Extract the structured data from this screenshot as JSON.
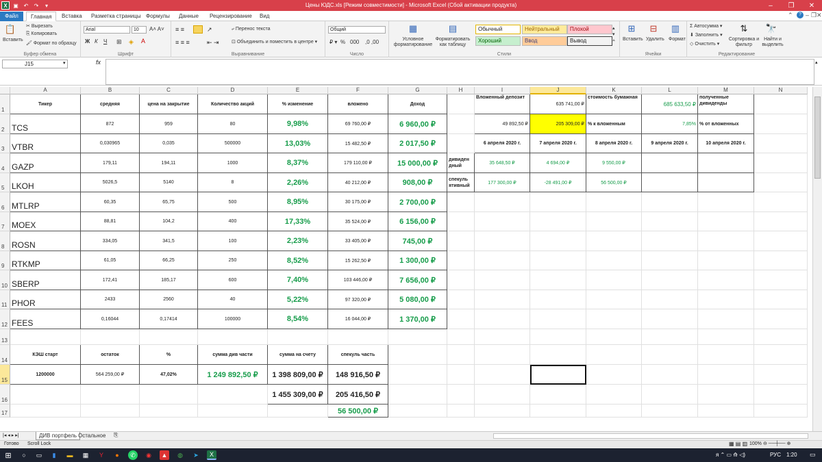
{
  "window": {
    "title": "Цены ЮДС.xls  [Режим совместимости]  -  Microsoft Excel (Сбой активации продукта)"
  },
  "menu": {
    "tabs": [
      "Файл",
      "Главная",
      "Вставка",
      "Разметка страницы",
      "Формулы",
      "Данные",
      "Рецензирование",
      "Вид"
    ]
  },
  "ribbon": {
    "clipboard": {
      "label": "Буфер обмена",
      "paste": "Вставить",
      "cut": "Вырезать",
      "copy": "Копировать",
      "format_painter": "Формат по образцу"
    },
    "font": {
      "label": "Шрифт",
      "name": "Arial",
      "size": "10",
      "bold": "Ж",
      "italic": "К",
      "underline": "Ч"
    },
    "alignment": {
      "label": "Выравнивание",
      "wrap": "Перенос текста",
      "merge": "Объединить и поместить в центре"
    },
    "number": {
      "label": "Число",
      "format": "Общий",
      "percent": "%",
      "thousands": "000"
    },
    "styles": {
      "label": "Стили",
      "conditional": "Условное форматирование",
      "as_table": "Форматировать как таблицу",
      "normal": "Обычный",
      "neutral": "Нейтральный",
      "bad": "Плохой",
      "good": "Хороший",
      "input": "Ввод",
      "output": "Вывод"
    },
    "cells": {
      "label": "Ячейки",
      "insert": "Вставить",
      "delete": "Удалить",
      "format": "Формат"
    },
    "editing": {
      "label": "Редактирование",
      "autosum": "Автосумма",
      "fill": "Заполнить",
      "clear": "Очистить",
      "sort": "Сортировка и фильтр",
      "find": "Найти и выделить"
    }
  },
  "namebox": "J15",
  "fx": "fx",
  "columns": [
    "A",
    "B",
    "C",
    "D",
    "E",
    "F",
    "G",
    "H",
    "I",
    "J",
    "K",
    "L",
    "M",
    "N"
  ],
  "rows": [
    "1",
    "2",
    "3",
    "4",
    "5",
    "6",
    "7",
    "8",
    "9",
    "10",
    "11",
    "12",
    "13",
    "14",
    "15",
    "16",
    "17"
  ],
  "cells": {
    "A1": "Тикер",
    "B1": "средняя",
    "C1": "цена на закрытие",
    "D1": "Количество акций",
    "E1": "% изменение",
    "F1": "вложено",
    "G1": "Доход",
    "I1": "Вложенный депозит",
    "J1": "635 741,00 ₽",
    "K1": "стоимость бумажная",
    "L1": "685 633,50 ₽",
    "M1": "полученные дивиденды",
    "A2": "TCS",
    "B2": "872",
    "C2": "959",
    "D2": "80",
    "E2": "9,98%",
    "F2": "69 760,00 ₽",
    "G2": "6 960,00 ₽",
    "I2": "49 892,50 ₽",
    "J2": "205 309,00 ₽",
    "K2": "% к вложенным",
    "L2": "7,85%",
    "M2": "% от вложенных",
    "A3": "VTBR",
    "B3": "0,030965",
    "C3": "0,035",
    "D3": "500000",
    "E3": "13,03%",
    "F3": "15 482,50 ₽",
    "G3": "2 017,50 ₽",
    "I3": "6 апреля 2020 г.",
    "J3": "7 апреля 2020 г.",
    "K3": "8 апреля 2020 г.",
    "L3": "9 апреля 2020 г.",
    "M3": "10 апреля 2020 г.",
    "A4": "GAZP",
    "B4": "179,11",
    "C4": "194,11",
    "D4": "1000",
    "E4": "8,37%",
    "F4": "179 110,00 ₽",
    "G4": "15 000,00 ₽",
    "H4": "дивиден дный",
    "I4": "35 648,50 ₽",
    "J4": "4 694,00 ₽",
    "K4": "9 550,00 ₽",
    "A5": "LKOH",
    "B5": "5026,5",
    "C5": "5140",
    "D5": "8",
    "E5": "2,26%",
    "F5": "40 212,00 ₽",
    "G5": "908,00 ₽",
    "H5": "спекуль ятивный",
    "I5": "177 300,00 ₽",
    "J5": "-28 491,00 ₽",
    "K5": "56 500,00 ₽",
    "A6": "MTLRP",
    "B6": "60,35",
    "C6": "65,75",
    "D6": "500",
    "E6": "8,95%",
    "F6": "30 175,00 ₽",
    "G6": "2 700,00 ₽",
    "A7": "MOEX",
    "B7": "88,81",
    "C7": "104,2",
    "D7": "400",
    "E7": "17,33%",
    "F7": "35 524,00 ₽",
    "G7": "6 156,00 ₽",
    "A8": "ROSN",
    "B8": "334,05",
    "C8": "341,5",
    "D8": "100",
    "E8": "2,23%",
    "F8": "33 405,00 ₽",
    "G8": "745,00 ₽",
    "A9": "RTKMP",
    "B9": "61,05",
    "C9": "66,25",
    "D9": "250",
    "E9": "8,52%",
    "F9": "15 262,50 ₽",
    "G9": "1 300,00 ₽",
    "A10": "SBERP",
    "B10": "172,41",
    "C10": "185,17",
    "D10": "600",
    "E10": "7,40%",
    "F10": "103 446,00 ₽",
    "G10": "7 656,00 ₽",
    "A11": "PHOR",
    "B11": "2433",
    "C11": "2560",
    "D11": "40",
    "E11": "5,22%",
    "F11": "97 320,00 ₽",
    "G11": "5 080,00 ₽",
    "A12": "FEES",
    "B12": "0,16044",
    "C12": "0,17414",
    "D12": "100000",
    "E12": "8,54%",
    "F12": "16 044,00 ₽",
    "G12": "1 370,00 ₽",
    "A14": "КЭШ старт",
    "B14": "остаток",
    "C14": "%",
    "D14": "сумма див части",
    "E14": "сумма на счету",
    "F14": "спекуль часть",
    "A15": "1200000",
    "B15": "564 259,00 ₽",
    "C15": "47,02%",
    "D15": "1 249 892,50 ₽",
    "E15": "1 398 809,00 ₽",
    "F15": "148 916,50 ₽",
    "E16": "1 455 309,00 ₽",
    "F16": "205 416,50 ₽",
    "F17": "56 500,00 ₽"
  },
  "sheets": [
    "ДИВ портфель",
    "Остальное"
  ],
  "status": {
    "ready": "Готово",
    "scroll_lock": "Scroll Lock",
    "zoom": "100%"
  },
  "taskbar": {
    "lang": "РУС",
    "time": "1:20"
  }
}
